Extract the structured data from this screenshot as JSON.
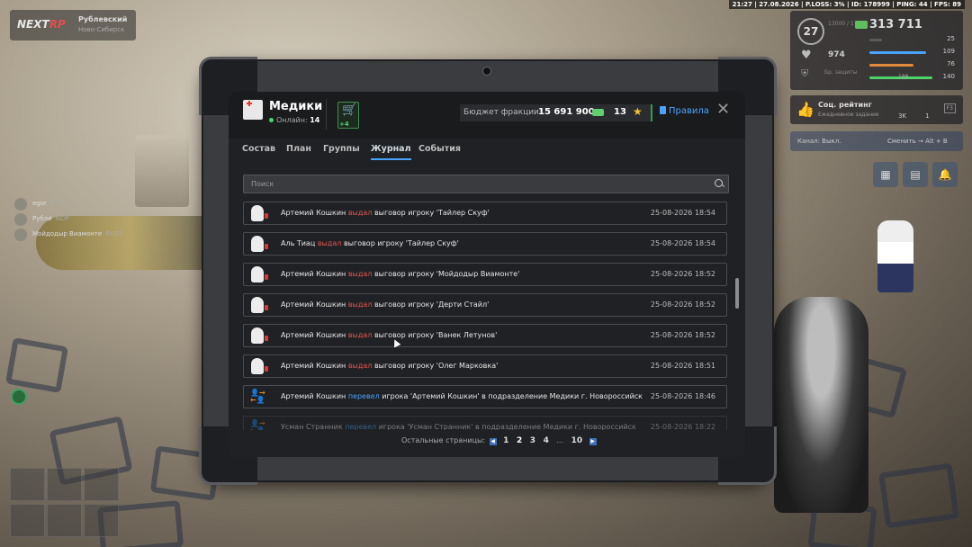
{
  "hud": {
    "logo": "NEXT",
    "logo_suffix": "RP",
    "location": "Рублевский",
    "location_sub": "Ново-Сибирск",
    "topbar": "21:27 | 27.08.2026 | P.LOSS: 3% | ID: 178999 | PING: 44 | FPS: 89",
    "level": "27",
    "level_sub": "13000 / 17000",
    "money": "313 711",
    "health_value": "974",
    "stats": [
      {
        "value": "25",
        "color": "#5a5a5a",
        "fill": 0.2
      },
      {
        "value": "109",
        "color": "#4aa3ff",
        "fill": 0.9
      },
      {
        "value": "76",
        "color": "#e08a3a",
        "fill": 0.7
      },
      {
        "value": "140",
        "color": "#4cd36a",
        "fill": 1.0
      }
    ],
    "armor_label": "Бр. защиты",
    "clock_small": "188",
    "social_title": "Соц. рейтинг",
    "social_sub": "Ежедневное задание",
    "social_k1": "3K",
    "social_k2": "1",
    "social_key": "F3",
    "channel_label": "Канал: Выкл.",
    "channel_switch": "Сменить → Alt + B",
    "players": [
      {
        "name": "egor",
        "tag": "S-MT"
      },
      {
        "name": "Рубли",
        "tag": "NDP"
      },
      {
        "name": "Мойдодыр Виамонте",
        "tag": "RUST"
      }
    ]
  },
  "tablet": {
    "faction_title": "Медики",
    "online_label": "Онлайн:",
    "online_count": "14",
    "cart_badge": "+4",
    "budget_label": "Бюджет фракции:",
    "budget_value": "15 691 900",
    "stars_value": "13",
    "rules_label": "Правила",
    "close_symbol": "✕",
    "tabs": [
      {
        "label": "Состав",
        "active": false
      },
      {
        "label": "План",
        "active": false
      },
      {
        "label": "Группы",
        "active": false
      },
      {
        "label": "Журнал",
        "active": true
      },
      {
        "label": "События",
        "active": false
      }
    ],
    "search_placeholder": "Поиск",
    "log": [
      {
        "icon": "reprimand-icon",
        "actor": "Артемий Кошкин",
        "action": "выдал",
        "rest": "выговор игроку 'Тайлер Скуф'",
        "datetime": "25-08-2026 18:54",
        "action_color": "red"
      },
      {
        "icon": "reprimand-icon",
        "actor": "Аль Тиац",
        "action": "выдал",
        "rest": "выговор игроку 'Тайлер Скуф'",
        "datetime": "25-08-2026 18:54",
        "action_color": "red"
      },
      {
        "icon": "reprimand-icon",
        "actor": "Артемий Кошкин",
        "action": "выдал",
        "rest": "выговор игроку 'Мойдодыр Виамонте'",
        "datetime": "25-08-2026 18:52",
        "action_color": "red"
      },
      {
        "icon": "reprimand-icon",
        "actor": "Артемий Кошкин",
        "action": "выдал",
        "rest": "выговор игроку 'Дерти Стайл'",
        "datetime": "25-08-2026 18:52",
        "action_color": "red"
      },
      {
        "icon": "reprimand-icon",
        "actor": "Артемий Кошкин",
        "action": "выдал",
        "rest": "выговор игроку 'Ванек Летунов'",
        "datetime": "25-08-2026 18:52",
        "action_color": "red"
      },
      {
        "icon": "reprimand-icon",
        "actor": "Артемий Кошкин",
        "action": "выдал",
        "rest": "выговор игроку 'Олег Марковка'",
        "datetime": "25-08-2026 18:51",
        "action_color": "red"
      },
      {
        "icon": "transfer-icon",
        "actor": "Артемий Кошкин",
        "action": "перевел",
        "rest": "игрока 'Артемий Кошкин' в подразделение Медики г. Новороссийск",
        "datetime": "25-08-2026 18:46",
        "action_color": "blue"
      },
      {
        "icon": "transfer-icon",
        "actor": "Усман Странник",
        "action": "перевел",
        "rest": "игрока 'Усман Странник' в подразделение Медики г. Новороссийск",
        "datetime": "25-08-2026 18:22",
        "action_color": "blue"
      }
    ],
    "pager_label": "Остальные страницы:",
    "pages": [
      "1",
      "2",
      "3",
      "4",
      "10"
    ],
    "current_page": "2",
    "ellipsis": "..."
  }
}
